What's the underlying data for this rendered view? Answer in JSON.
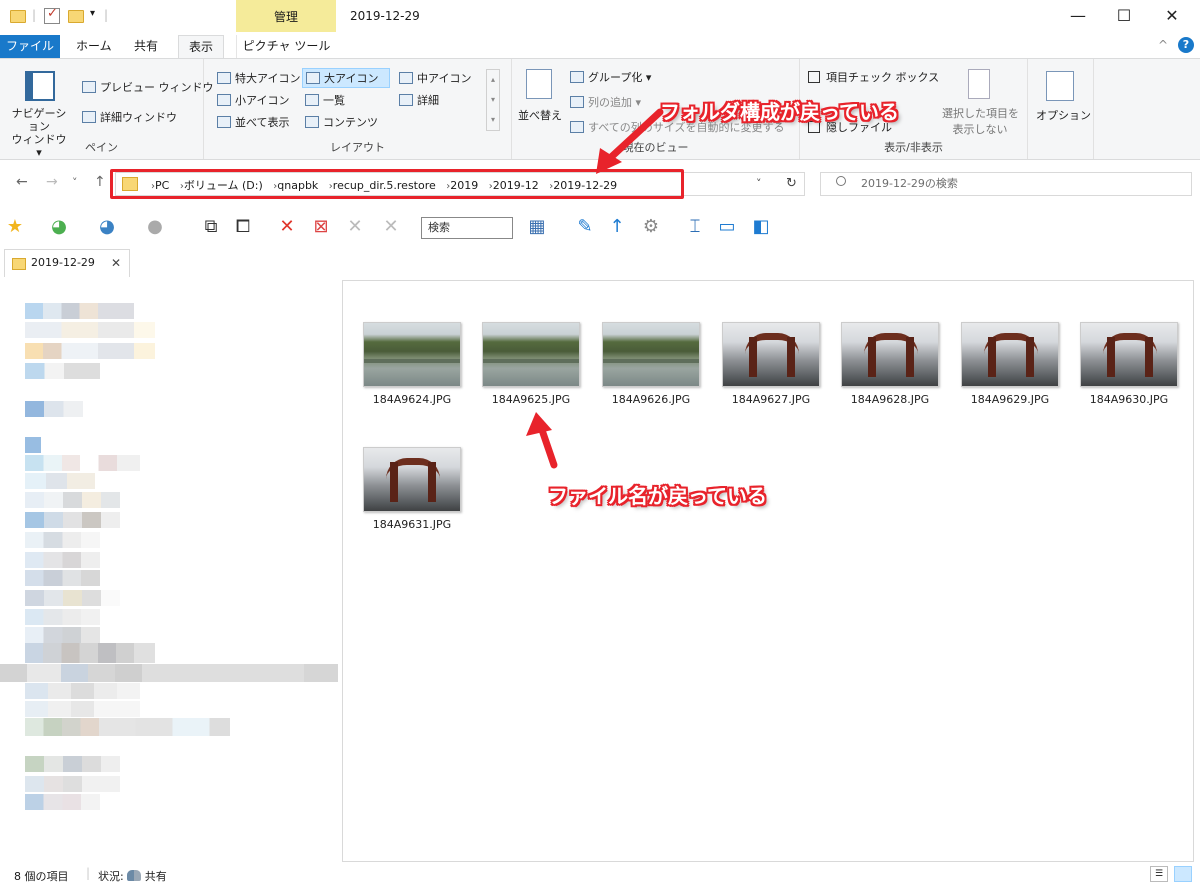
{
  "window": {
    "title": "2019-12-29",
    "context_tab_header": "管理",
    "minimize": "—",
    "maximize": "☐",
    "close": "✕"
  },
  "tabs": {
    "file": "ファイル",
    "home": "ホーム",
    "share": "共有",
    "view": "表示",
    "picture_tools": "ピクチャ ツール",
    "help_collapse": "^",
    "help": "?"
  },
  "ribbon": {
    "pane": {
      "label": "ペイン",
      "navigation_pane": "ナビゲーション\nウィンドウ ▾",
      "preview_pane": "プレビュー ウィンドウ",
      "details_pane": "詳細ウィンドウ"
    },
    "layout": {
      "label": "レイアウト",
      "items": [
        "特大アイコン",
        "大アイコン",
        "中アイコン",
        "小アイコン",
        "一覧",
        "詳細",
        "並べて表示",
        "コンテンツ"
      ],
      "selected": "大アイコン"
    },
    "current_view": {
      "label": "現在のビュー",
      "sort_by": "並べ替え",
      "group_by": "グループ化 ▾",
      "add_columns": "列の追加 ▾",
      "size_all_columns": "すべての列のサイズを自動的に変更する"
    },
    "show_hide": {
      "label": "表示/非表示",
      "item_check_boxes": "項目チェック ボックス",
      "hidden_items": "隠しファイル",
      "hide_selected_1": "選択した項目を",
      "hide_selected_2": "表示しない"
    },
    "options": "オプション"
  },
  "address": {
    "back": "←",
    "forward": "→",
    "recent": "˅",
    "up": "↑",
    "crumbs": [
      "PC",
      "ボリューム (D:)",
      "qnapbk",
      "recup_dir.5.restore",
      "2019",
      "2019-12",
      "2019-12-29"
    ],
    "separator": "›",
    "dropdown": "˅",
    "refresh": "↻",
    "search_placeholder": "2019-12-29の検索"
  },
  "toolbar2": {
    "search_label": "検索"
  },
  "folder_tab": {
    "label": "2019-12-29",
    "close": "✕"
  },
  "files": [
    {
      "name": "184A9624.JPG",
      "kind": "river"
    },
    {
      "name": "184A9625.JPG",
      "kind": "river"
    },
    {
      "name": "184A9626.JPG",
      "kind": "river"
    },
    {
      "name": "184A9627.JPG",
      "kind": "shrine"
    },
    {
      "name": "184A9628.JPG",
      "kind": "shrine"
    },
    {
      "name": "184A9629.JPG",
      "kind": "shrine"
    },
    {
      "name": "184A9630.JPG",
      "kind": "shrine"
    },
    {
      "name": "184A9631.JPG",
      "kind": "shrine"
    }
  ],
  "annotations": {
    "folder_restored": "フォルダ構成が戻っている",
    "filename_restored": "ファイル名が戻っている",
    "color": "#e8232b"
  },
  "status": {
    "item_count": "8 個の項目",
    "state_label": "状況:",
    "state_value": "共有"
  }
}
